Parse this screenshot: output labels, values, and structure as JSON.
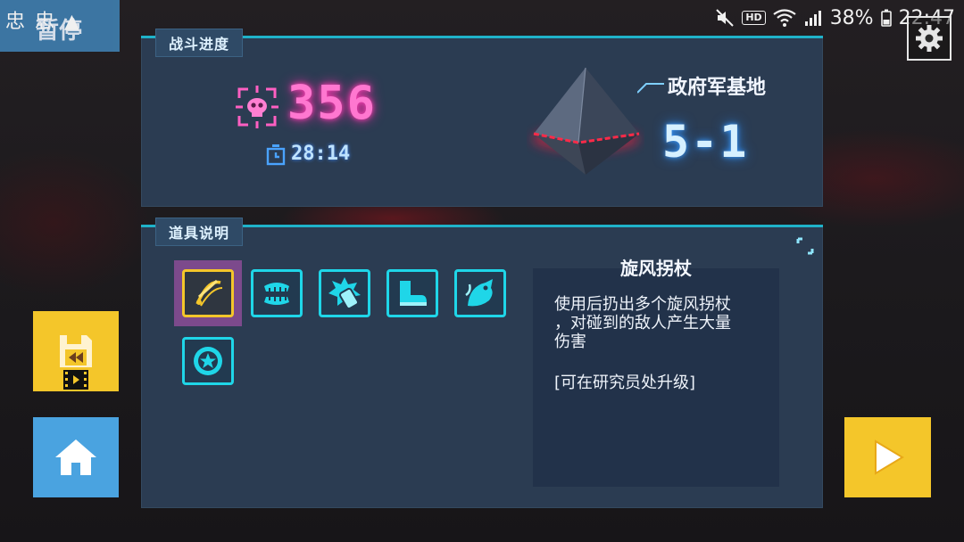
{
  "status_bar": {
    "left_icons": "忠 忠 ▲",
    "battery": "38%",
    "time": "22:47",
    "hd": "HD",
    "network": "4G"
  },
  "pause_label": "暂停",
  "battle": {
    "tag": "战斗进度",
    "kills": "356",
    "timer": "28:14",
    "location": "政府军基地",
    "stage": "5-1"
  },
  "items": {
    "tag": "道具说明",
    "slots": [
      {
        "name": "whirlwind-cane-icon",
        "selected": true
      },
      {
        "name": "teeth-icon",
        "selected": false
      },
      {
        "name": "grenade-icon",
        "selected": false
      },
      {
        "name": "boot-icon",
        "selected": false
      },
      {
        "name": "whirlwind-beast-icon",
        "selected": false
      },
      {
        "name": "star-medal-icon",
        "selected": false
      }
    ],
    "detail": {
      "title": "旋风拐杖",
      "line1": "使用后扔出多个旋风拐杖",
      "line2": "，对碰到的敌人产生大量",
      "line3": "伤害",
      "note": "[可在研究员处升级]"
    }
  },
  "colors": {
    "accent_cyan": "#1fd6e8",
    "kill_pink": "#ff77d0",
    "button_yellow": "#f4c62a",
    "button_blue": "#4aa3e0",
    "panel": "#2b3c52"
  }
}
